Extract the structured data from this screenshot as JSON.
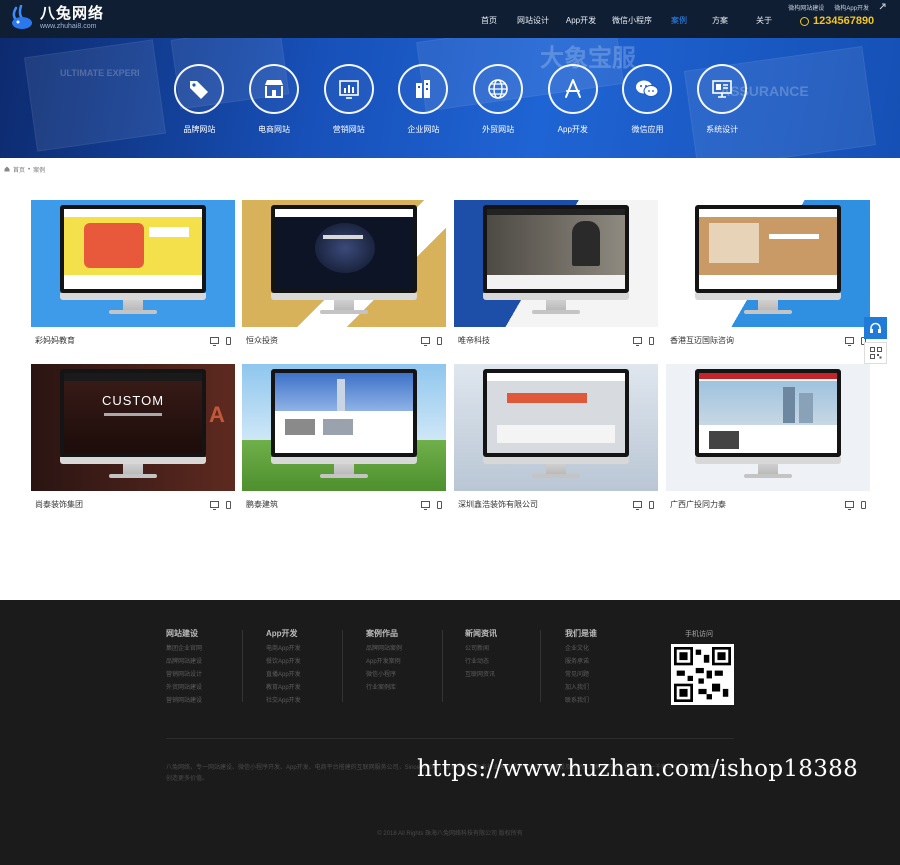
{
  "header": {
    "logo_name": "八兔网络",
    "logo_url": "www.zhuhai8.com",
    "nav": [
      "首页",
      "网站设计",
      "App开发",
      "微信小程序",
      "案例",
      "方案",
      "关于"
    ],
    "active_nav": 4,
    "top_links": [
      "微构网站建设",
      "微构App开发"
    ],
    "phone": "1234567890"
  },
  "banner": {
    "categories": [
      {
        "label": "品牌网站",
        "icon": "tag-icon"
      },
      {
        "label": "电商网站",
        "icon": "shop-icon"
      },
      {
        "label": "营销网站",
        "icon": "chart-icon"
      },
      {
        "label": "企业网站",
        "icon": "building-icon"
      },
      {
        "label": "外贸网站",
        "icon": "globe-icon"
      },
      {
        "label": "App开发",
        "icon": "app-store-icon"
      },
      {
        "label": "微信应用",
        "icon": "wechat-icon"
      },
      {
        "label": "系统设计",
        "icon": "system-icon"
      }
    ]
  },
  "breadcrumb": {
    "home": "首页",
    "current": "案例"
  },
  "cases": [
    {
      "title": "彩妈妈教育"
    },
    {
      "title": "恒众投资"
    },
    {
      "title": "唯帝科技"
    },
    {
      "title": "香港互迈国际咨询"
    },
    {
      "title": "尚泰装饰集团",
      "screen_text": "CUSTOM"
    },
    {
      "title": "鹏泰建筑"
    },
    {
      "title": "深圳鑫浩装饰有限公司"
    },
    {
      "title": "广西广投同力泰"
    }
  ],
  "footer": {
    "columns": [
      {
        "title": "网站建设",
        "links": [
          "集团企业官网",
          "品牌网站建设",
          "营销网站设计",
          "外贸网站建设",
          "营销网站建设"
        ]
      },
      {
        "title": "App开发",
        "links": [
          "电商App开发",
          "餐饮App开发",
          "直播App开发",
          "教育App开发",
          "社交App开发"
        ]
      },
      {
        "title": "案例作品",
        "links": [
          "品牌网站案例",
          "App开发案例",
          "微信小程序",
          "行业案例库"
        ]
      },
      {
        "title": "新闻资讯",
        "links": [
          "公司新闻",
          "行业动态",
          "互联网资讯"
        ]
      },
      {
        "title": "我们是谁",
        "links": [
          "企业文化",
          "服务承诺",
          "常见问题",
          "加入我们",
          "联系我们"
        ]
      }
    ],
    "mobile_visit": "手机访问",
    "description": "八兔网络，专一网站建设、微信小程序开发、App开发、电商平台搭建的互联网服务公司，Since2009年，深耕一线，为各行业客户提供专业的网站建设及移动应用解决方案，服务超过一千家中小企业，致力于为客户创造更多价值。",
    "copyright": "© 2018 All Rights 珠海八兔网络科技有限公司 版权所有",
    "watermark": "https://www.huzhan.com/ishop18388"
  }
}
